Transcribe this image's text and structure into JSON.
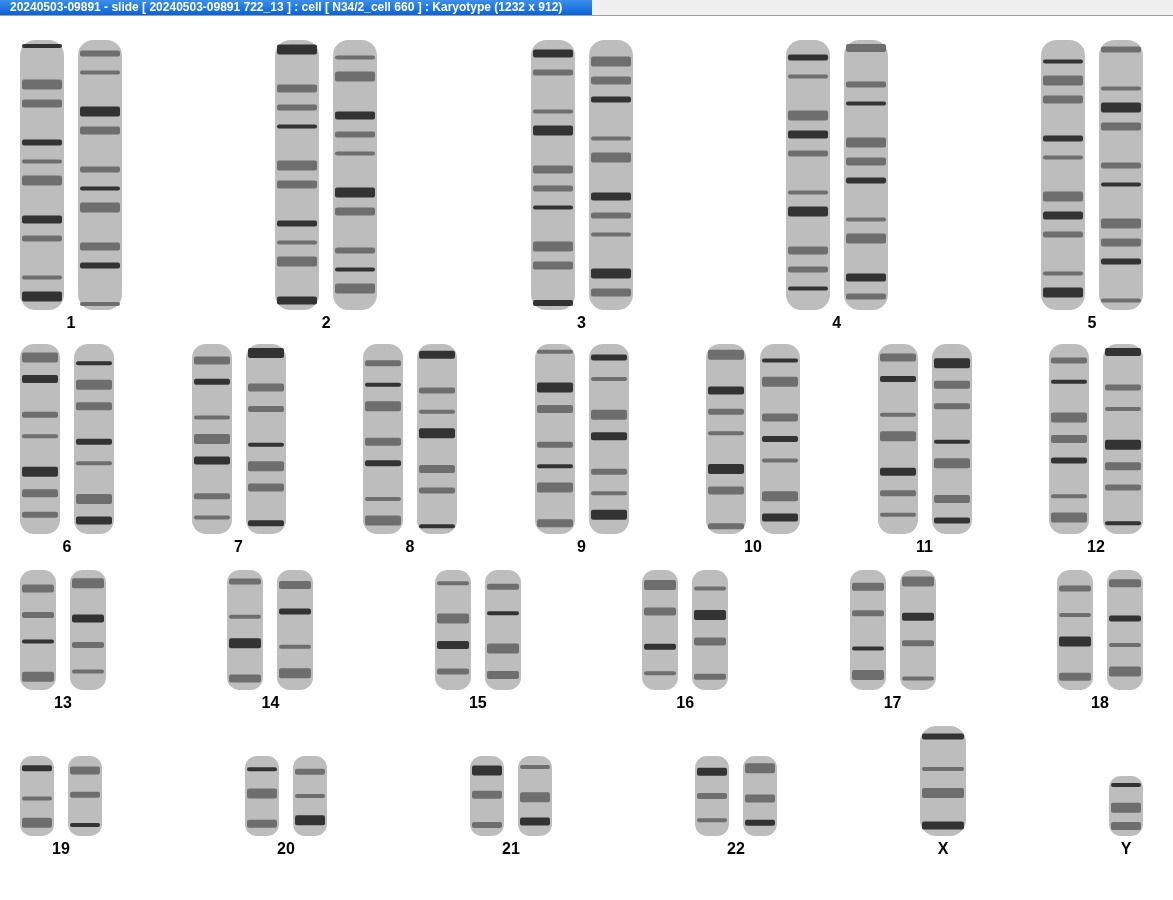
{
  "window": {
    "title": "20240503-09891 - slide [ 20240503-09891 722_13 ] : cell [ N34/2_cell 660 ] : Karyotype  (1232 x 912)"
  },
  "rows": [
    {
      "groups": [
        {
          "label": "1",
          "kind": "pair"
        },
        {
          "label": "2",
          "kind": "pair"
        },
        {
          "label": "3",
          "kind": "pair"
        },
        {
          "label": "4",
          "kind": "pair"
        },
        {
          "label": "5",
          "kind": "pair"
        }
      ]
    },
    {
      "groups": [
        {
          "label": "6",
          "kind": "pair"
        },
        {
          "label": "7",
          "kind": "pair"
        },
        {
          "label": "8",
          "kind": "pair"
        },
        {
          "label": "9",
          "kind": "pair"
        },
        {
          "label": "10",
          "kind": "pair"
        },
        {
          "label": "11",
          "kind": "pair"
        },
        {
          "label": "12",
          "kind": "pair"
        }
      ]
    },
    {
      "groups": [
        {
          "label": "13",
          "kind": "pair"
        },
        {
          "label": "14",
          "kind": "pair"
        },
        {
          "label": "15",
          "kind": "pair"
        },
        {
          "label": "16",
          "kind": "pair"
        },
        {
          "label": "17",
          "kind": "pair"
        },
        {
          "label": "18",
          "kind": "pair"
        }
      ]
    },
    {
      "groups": [
        {
          "label": "19",
          "kind": "pair"
        },
        {
          "label": "20",
          "kind": "pair"
        },
        {
          "label": "21",
          "kind": "pair"
        },
        {
          "label": "22",
          "kind": "pair"
        },
        {
          "label": "X",
          "kind": "single"
        },
        {
          "label": "Y",
          "kind": "single"
        }
      ]
    }
  ]
}
